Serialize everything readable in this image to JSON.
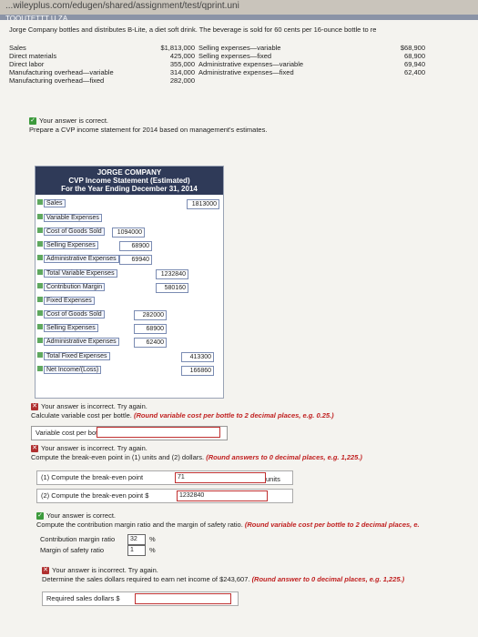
{
  "browser": {
    "url": "...wileyplus.com/edugen/shared/assignment/test/qprint.uni",
    "tab": "TOOUTETTT U ZA"
  },
  "intro": "Jorge Company bottles and distributes B-Lite, a diet soft drink. The beverage is sold for 60 cents per 16-ounce bottle to re",
  "costs_left": [
    {
      "label": "Sales",
      "value": "$1,813,000"
    },
    {
      "label": "Direct materials",
      "value": "425,000"
    },
    {
      "label": "Direct labor",
      "value": "355,000"
    },
    {
      "label": "Manufacturing overhead—variable",
      "value": "314,000"
    },
    {
      "label": "Manufacturing overhead—fixed",
      "value": "282,000"
    }
  ],
  "costs_right": [
    {
      "label": "Selling expenses—variable",
      "value": "$68,900"
    },
    {
      "label": "Selling expenses—fixed",
      "value": "68,900"
    },
    {
      "label": "Administrative expenses—variable",
      "value": "69,940"
    },
    {
      "label": "Administrative expenses—fixed",
      "value": "62,400"
    }
  ],
  "msg1": "Your answer is correct.",
  "prompt1": "Prepare a CVP income statement for 2014 based on management's estimates.",
  "cvp": {
    "h1": "JORGE COMPANY",
    "h2": "CVP Income Statement (Estimated)",
    "h3": "For the Year Ending December 31, 2014",
    "sales_label": "Sales",
    "sales_value": "1813000",
    "var_label": "Variable Expenses",
    "cogs_v_label": "Cost of Goods Sold",
    "cogs_v": "1094000",
    "sell_v_label": "Selling Expenses",
    "sell_v": "68900",
    "admin_v_label": "Administrative Expenses",
    "admin_v": "69940",
    "tot_v_label": "Total Variable Expenses",
    "tot_v": "1232840",
    "cm_label": "Contribution Margin",
    "cm": "580160",
    "fix_label": "Fixed Expenses",
    "cogs_f_label": "Cost of Goods Sold",
    "cogs_f": "282000",
    "sell_f_label": "Selling Expenses",
    "sell_f": "68900",
    "admin_f_label": "Administrative Expenses",
    "admin_f": "62400",
    "tot_f_label": "Total Fixed Expenses",
    "tot_f": "413300",
    "ni_label": "Net Income/(Loss)",
    "ni": "166860"
  },
  "msg2": "Your answer is incorrect.  Try again.",
  "prompt2a": "Calculate variable cost per bottle.",
  "note2": "(Round variable cost per bottle to 2 decimal places, e.g. 0.25.)",
  "vc_label": "Variable cost per bottle",
  "vc_prefix": "$",
  "msg3": "Your answer is incorrect.  Try again.",
  "prompt3a": "Compute the break-even point in (1) units and (2) dollars.",
  "note3": "(Round answers to 0 decimal places, e.g. 1,225.)",
  "be1_label": "(1)  Compute the break-even point",
  "be1_value": "71",
  "be1_unit": "units",
  "be2_label": "(2)  Compute the break-even point",
  "be2_prefix": "$",
  "be2_value": "1232840",
  "msg4": "Your answer is correct.",
  "prompt4a": "Compute the contribution margin ratio and the margin of safety ratio.",
  "note4": "(Round variable cost per bottle to 2 decimal places, e.",
  "cmr_label": "Contribution margin ratio",
  "cmr_value": "32",
  "mos_label": "Margin of safety ratio",
  "mos_value": "1",
  "pct": "%",
  "msg5": "Your answer is incorrect.  Try again.",
  "prompt5a": "Determine the sales dollars required to earn net income of $243,607.",
  "note5": "(Round answer to 0 decimal places, e.g. 1,225.)",
  "req_label": "Required sales dollars",
  "req_prefix": "$"
}
